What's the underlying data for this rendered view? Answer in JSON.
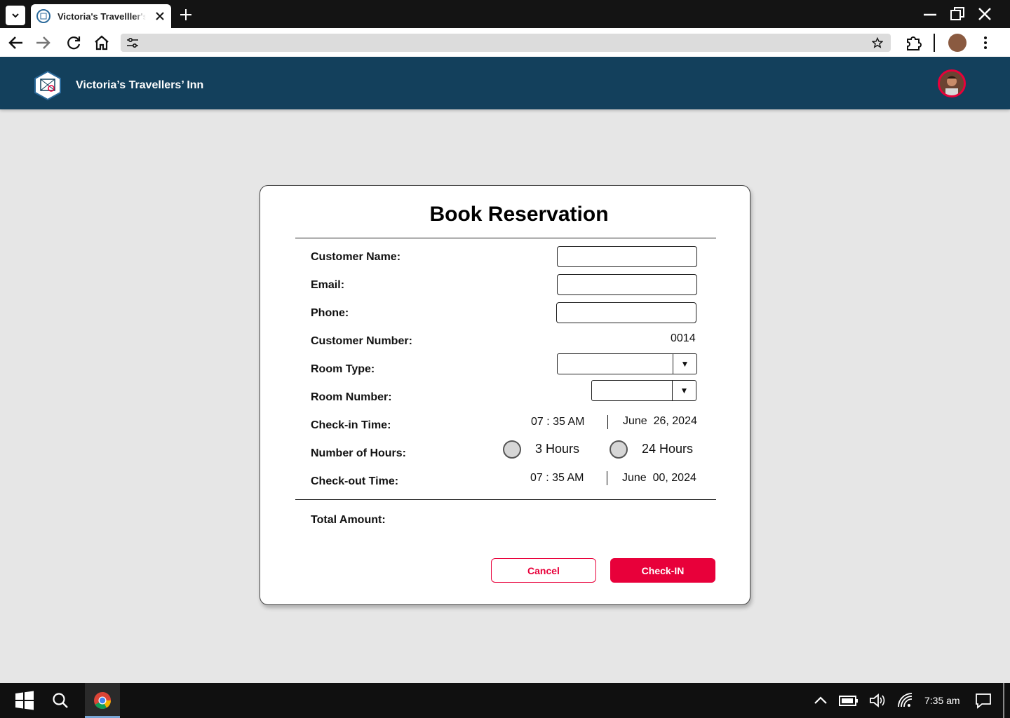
{
  "browser": {
    "tab_title": "Victoria's Travelller's",
    "url": ""
  },
  "app": {
    "title": "Victoria’s Travellers’ Inn"
  },
  "form": {
    "title": "Book Reservation",
    "labels": {
      "customer_name": "Customer Name:",
      "email": "Email:",
      "phone": "Phone:",
      "customer_number": "Customer Number:",
      "room_type": "Room Type:",
      "room_number": "Room Number:",
      "checkin_time": "Check-in Time:",
      "number_of_hours": "Number of Hours:",
      "checkout_time": "Check-out Time:",
      "total_amount": "Total Amount:"
    },
    "values": {
      "customer_name": "",
      "email": "",
      "phone": "",
      "customer_number": "0014",
      "room_type": "",
      "room_number": "",
      "checkin_time": "07 : 35 AM",
      "checkin_date": "June  26, 2024",
      "checkout_time": "07 : 35 AM",
      "checkout_date": "June  00, 2024",
      "total_amount": ""
    },
    "hours_options": [
      "3 Hours",
      "24 Hours"
    ],
    "buttons": {
      "cancel": "Cancel",
      "checkin": "Check-IN"
    },
    "dropdown_arrow": "▼"
  },
  "taskbar": {
    "time": "7:35 am"
  },
  "colors": {
    "appbar": "#13405c",
    "accent": "#e8003a",
    "background": "#e6e6e6"
  }
}
